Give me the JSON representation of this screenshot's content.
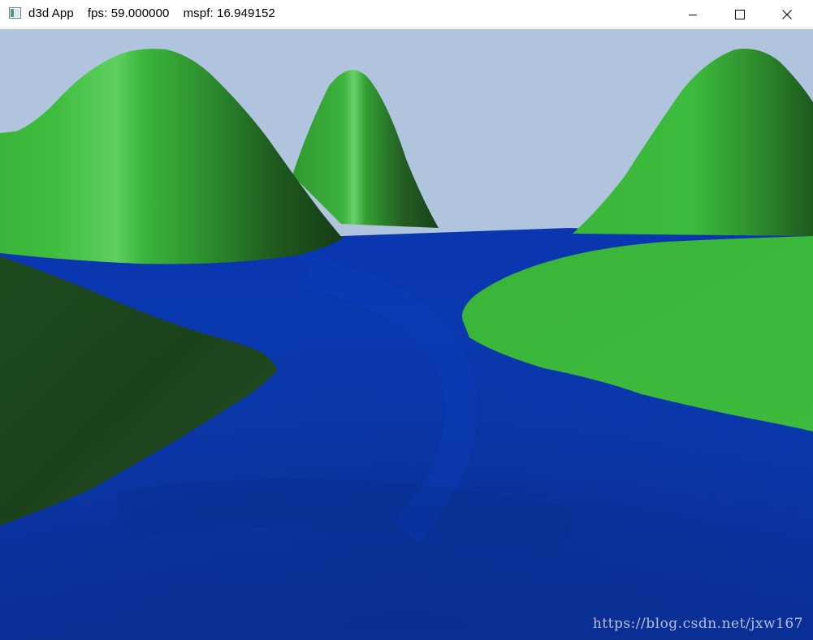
{
  "window": {
    "app_title": "d3d App",
    "fps_label": "fps: 59.000000",
    "mspf_label": "mspf: 16.949152",
    "controls": {
      "minimize_icon": "minimize-icon",
      "maximize_icon": "maximize-icon",
      "close_icon": "close-icon"
    }
  },
  "scene": {
    "sky_color": "#b0c4de",
    "water_color": "#0a36a8",
    "hill_color": "#3cb43c",
    "hill_shadow_color": "#1a4a1a"
  },
  "watermark": "https://blog.csdn.net/jxw167"
}
